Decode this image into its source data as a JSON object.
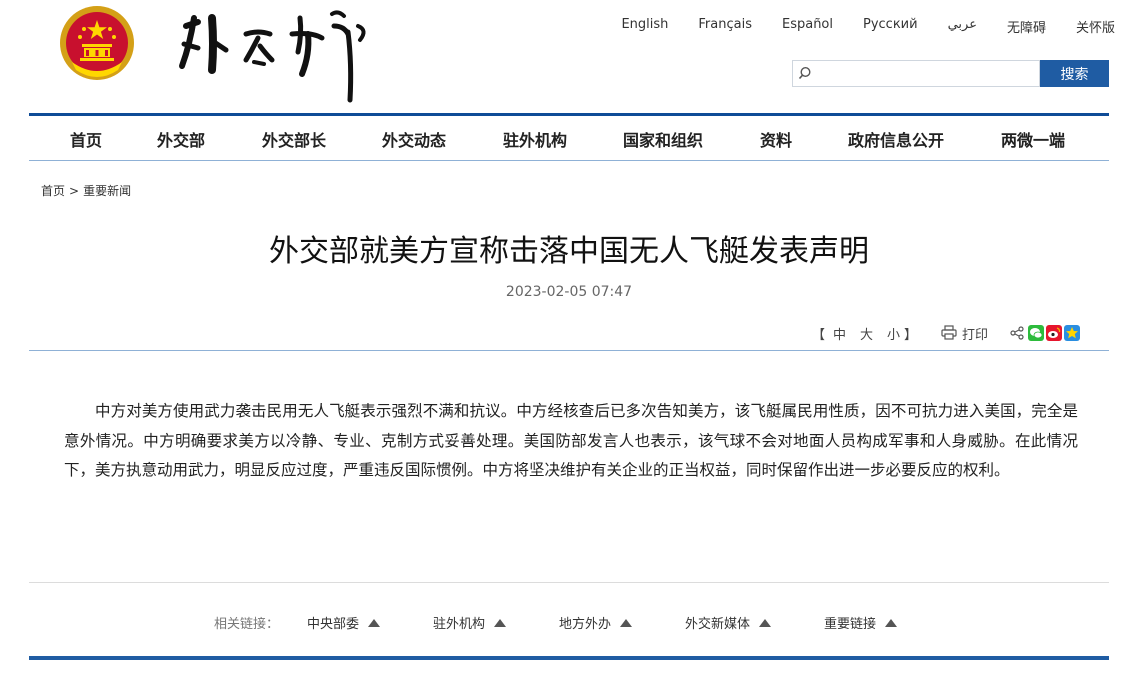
{
  "header": {
    "languages": [
      "English",
      "Français",
      "Español",
      "Русский",
      "عربي",
      "无障碍",
      "关怀版"
    ],
    "search": {
      "value": "",
      "button_label": "搜索"
    }
  },
  "nav": {
    "items": [
      "首页",
      "外交部",
      "外交部长",
      "外交动态",
      "驻外机构",
      "国家和组织",
      "资料",
      "政府信息公开",
      "两微一端"
    ]
  },
  "breadcrumb": {
    "home": "首页",
    "separator": ">",
    "current": "重要新闻"
  },
  "article": {
    "title": "外交部就美方宣称击落中国无人飞艇发表声明",
    "date": "2023-02-05 07:47",
    "body": "中方对美方使用武力袭击民用无人飞艇表示强烈不满和抗议。中方经核查后已多次告知美方，该飞艇属民用性质，因不可抗力进入美国，完全是意外情况。中方明确要求美方以冷静、专业、克制方式妥善处理。美国防部发言人也表示，该气球不会对地面人员构成军事和人身威胁。在此情况下，美方执意动用武力，明显反应过度，严重违反国际惯例。中方将坚决维护有关企业的正当权益，同时保留作出进一步必要反应的权利。"
  },
  "tools": {
    "bracket_open": "【",
    "font_large": "中",
    "font_medium": "大",
    "font_small": "小",
    "bracket_close": "】",
    "print_label": "打印",
    "icons": [
      "share-icon",
      "wechat-icon",
      "weibo-icon",
      "qzone-icon"
    ]
  },
  "footer": {
    "links_label": "相关链接：",
    "links": [
      "中央部委",
      "驻外机构",
      "地方外办",
      "外交新媒体",
      "重要链接"
    ]
  },
  "colors": {
    "brand_blue": "#1f5ca3",
    "nav_border": "#0f4c97",
    "divider": "#8fb1d6"
  }
}
